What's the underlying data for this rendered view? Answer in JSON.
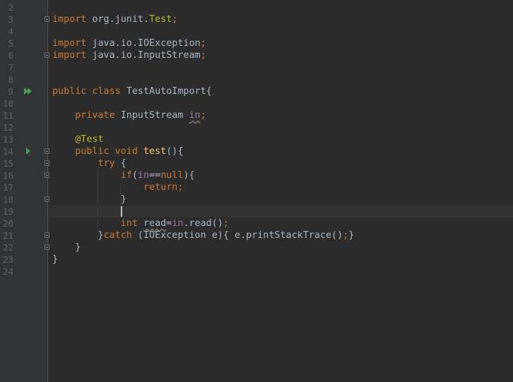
{
  "editor": {
    "current_line": "19",
    "lines": [
      {
        "num": "2",
        "t": []
      },
      {
        "num": "3",
        "t": [
          {
            "text": "import",
            "cls": "kw"
          },
          {
            "text": " org.junit.",
            "cls": "plain"
          },
          {
            "text": "Test",
            "cls": "ann"
          },
          {
            "text": ";",
            "cls": "kw"
          }
        ]
      },
      {
        "num": "4",
        "t": []
      },
      {
        "num": "5",
        "t": [
          {
            "text": "import",
            "cls": "kw"
          },
          {
            "text": " java.io.IOException",
            "cls": "plain"
          },
          {
            "text": ";",
            "cls": "kw"
          }
        ]
      },
      {
        "num": "6",
        "t": [
          {
            "text": "import",
            "cls": "kw"
          },
          {
            "text": " java.io.InputStream",
            "cls": "plain"
          },
          {
            "text": ";",
            "cls": "kw"
          }
        ]
      },
      {
        "num": "7",
        "t": []
      },
      {
        "num": "8",
        "t": []
      },
      {
        "num": "9",
        "t": [
          {
            "text": "public class",
            "cls": "kw"
          },
          {
            "text": " TestAutoImport{",
            "cls": "plain"
          }
        ]
      },
      {
        "num": "10",
        "t": []
      },
      {
        "num": "11",
        "t": [
          {
            "text": "    "
          },
          {
            "text": "private",
            "cls": "kw"
          },
          {
            "text": " InputStream ",
            "cls": "plain"
          },
          {
            "text": "in",
            "cls": "fld warn"
          },
          {
            "text": ";",
            "cls": "kw"
          }
        ]
      },
      {
        "num": "12",
        "t": []
      },
      {
        "num": "13",
        "t": [
          {
            "text": "    "
          },
          {
            "text": "@Test",
            "cls": "ann"
          }
        ]
      },
      {
        "num": "14",
        "t": [
          {
            "text": "    "
          },
          {
            "text": "public void",
            "cls": "kw"
          },
          {
            "text": " "
          },
          {
            "text": "test",
            "cls": "fn"
          },
          {
            "text": "(){",
            "cls": "plain"
          }
        ]
      },
      {
        "num": "15",
        "t": [
          {
            "text": "        "
          },
          {
            "text": "try",
            "cls": "kw"
          },
          {
            "text": " {",
            "cls": "plain"
          }
        ]
      },
      {
        "num": "16",
        "t": [
          {
            "text": "            "
          },
          {
            "text": "if",
            "cls": "kw"
          },
          {
            "text": "(",
            "cls": "plain"
          },
          {
            "text": "in",
            "cls": "fld"
          },
          {
            "text": "==",
            "cls": "plain"
          },
          {
            "text": "null",
            "cls": "kw"
          },
          {
            "text": "){",
            "cls": "plain"
          }
        ]
      },
      {
        "num": "17",
        "t": [
          {
            "text": "                "
          },
          {
            "text": "return;",
            "cls": "kw"
          }
        ]
      },
      {
        "num": "18",
        "t": [
          {
            "text": "            "
          },
          {
            "text": "}",
            "cls": "plain"
          }
        ]
      },
      {
        "num": "19",
        "t": [
          {
            "text": "            "
          }
        ],
        "caret": true
      },
      {
        "num": "20",
        "t": [
          {
            "text": "            "
          },
          {
            "text": "int",
            "cls": "kw"
          },
          {
            "text": " "
          },
          {
            "text": "read",
            "cls": "plain warn"
          },
          {
            "text": "=",
            "cls": "plain"
          },
          {
            "text": "in",
            "cls": "fld"
          },
          {
            "text": ".read()",
            "cls": "plain"
          },
          {
            "text": ";",
            "cls": "kw"
          }
        ]
      },
      {
        "num": "21",
        "t": [
          {
            "text": "        "
          },
          {
            "text": "}",
            "cls": "plain"
          },
          {
            "text": "catch",
            "cls": "kw"
          },
          {
            "text": " (IOException e){ e.printStackTrace()",
            "cls": "plain"
          },
          {
            "text": ";",
            "cls": "kw"
          },
          {
            "text": "}",
            "cls": "plain"
          }
        ]
      },
      {
        "num": "22",
        "t": [
          {
            "text": "    "
          },
          {
            "text": "}",
            "cls": "plain"
          }
        ]
      },
      {
        "num": "23",
        "t": [
          {
            "text": "}",
            "cls": "plain"
          }
        ]
      },
      {
        "num": "24",
        "t": []
      }
    ],
    "fold_markers": [
      "3",
      "6",
      "14",
      "15",
      "16",
      "18",
      "21",
      "22"
    ],
    "run_markers": [
      {
        "line": "9",
        "icon": "run-class-icon"
      },
      {
        "line": "14",
        "icon": "run-test-icon"
      }
    ],
    "colors": {
      "background": "#2b2b2b",
      "gutter": "#313335",
      "keyword": "#cc7832",
      "annotation": "#bbb529",
      "field": "#9876aa",
      "method": "#ffc66d",
      "text": "#a9b7c6",
      "line_number": "#606366",
      "run_icon": "#499c54"
    }
  }
}
